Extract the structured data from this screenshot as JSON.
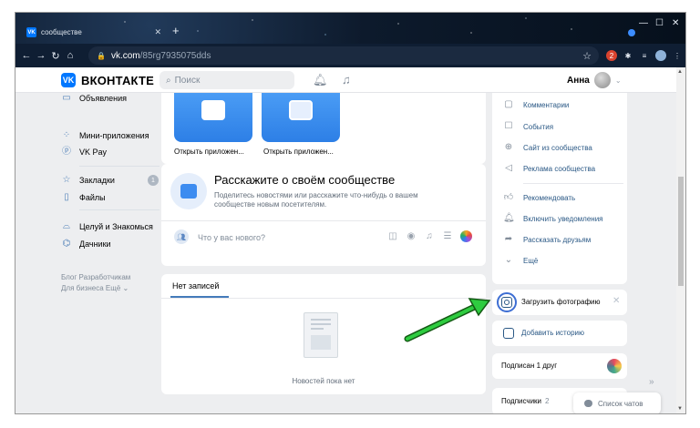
{
  "browser": {
    "tab_title": "сообществе",
    "tab_favicon": "VK",
    "url_host": "vk.com",
    "url_path": "/85rg7935075dds",
    "ext_badge": "2"
  },
  "header": {
    "brand": "ВКОНТАКТЕ",
    "logo_letter": "VK",
    "search_placeholder": "Поиск",
    "user_name": "Анна"
  },
  "left_menu": {
    "items": [
      {
        "label": "Объявления",
        "icon": "ad-icon"
      },
      {
        "label": "Мини-приложения",
        "icon": "apps-icon"
      },
      {
        "label": "VK Pay",
        "icon": "vkpay-icon"
      },
      {
        "label": "Закладки",
        "icon": "star-icon",
        "count": "1"
      },
      {
        "label": "Файлы",
        "icon": "file-icon"
      },
      {
        "label": "Целуй и Знакомься",
        "icon": "game-icon"
      },
      {
        "label": "Дачники",
        "icon": "gamepad-icon"
      }
    ],
    "footer_line1": "Блог  Разработчикам",
    "footer_line2": "Для бизнеса  Ещё ⌄"
  },
  "apps": [
    {
      "label": "Открыть приложен..."
    },
    {
      "label": "Открыть приложен..."
    }
  ],
  "story_prompt": {
    "title": "Расскажите о своём сообществе",
    "subtitle": "Поделитесь новостями или расскажите что-нибудь о вашем сообществе новым посетителям.",
    "input_placeholder": "Что у вас нового?"
  },
  "feed": {
    "tab": "Нет записей",
    "empty_text": "Новостей пока нет"
  },
  "right_menu": {
    "items": [
      {
        "label": "Комментарии",
        "icon": "comment-icon"
      },
      {
        "label": "События",
        "icon": "event-icon"
      },
      {
        "label": "Сайт из сообщества",
        "icon": "globe-icon"
      },
      {
        "label": "Реклама сообщества",
        "icon": "megaphone-icon"
      },
      {
        "label": "Рекомендовать",
        "icon": "like-icon"
      },
      {
        "label": "Включить уведомления",
        "icon": "bell-icon"
      },
      {
        "label": "Рассказать друзьям",
        "icon": "share-icon"
      },
      {
        "label": "Ещё",
        "icon": "chevron-down-icon"
      }
    ]
  },
  "upload_photo": {
    "label": "Загрузить фотографию"
  },
  "add_story": {
    "label": "Добавить историю"
  },
  "subscribed": {
    "label": "Подписан 1 друг"
  },
  "followers": {
    "label": "Подписчики",
    "count": "2"
  },
  "chat_list": {
    "label": "Список чатов"
  },
  "colors": {
    "vk_blue": "#0077ff",
    "link": "#2a5885",
    "arrow_green": "#2ecc40",
    "bg": "#edeef0"
  }
}
